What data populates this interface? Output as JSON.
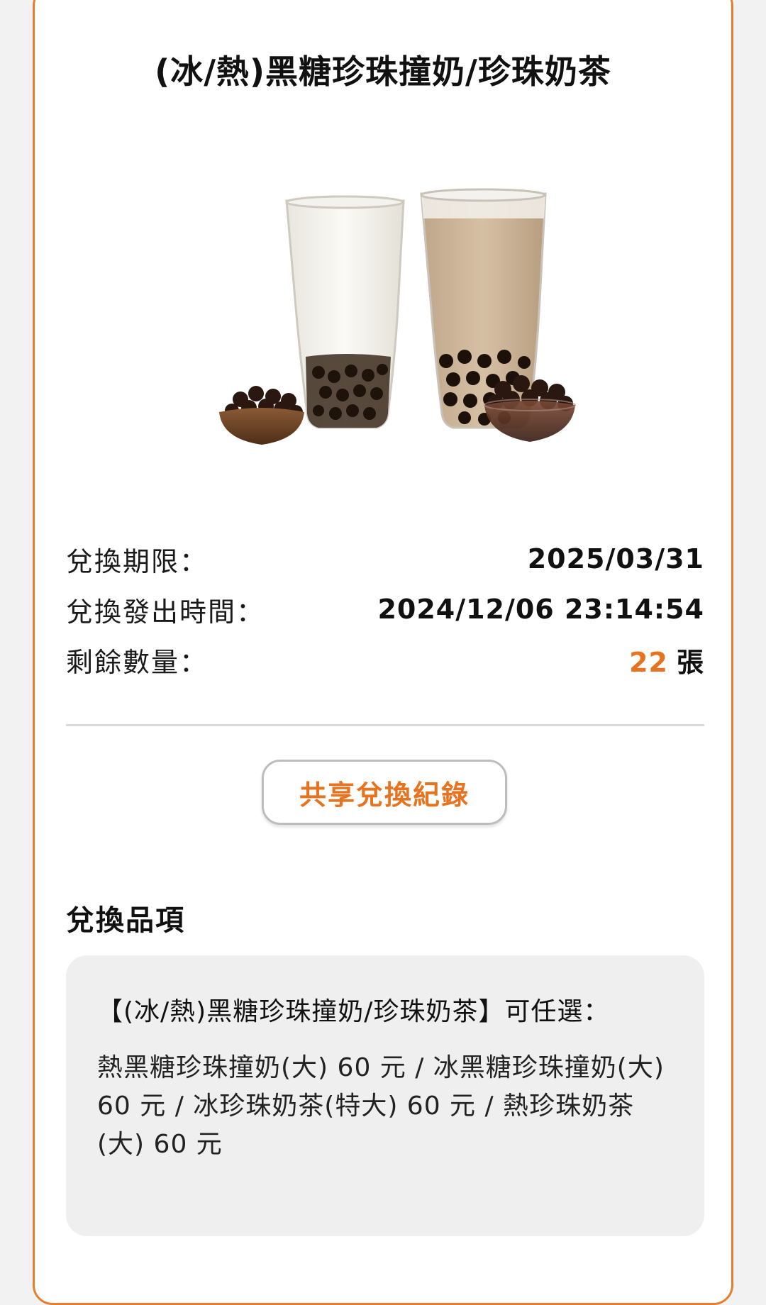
{
  "product": {
    "title": "(冰/熱)黑糖珍珠撞奶/珍珠奶茶"
  },
  "info": {
    "expiry_label": "兌換期限：",
    "expiry_value": "2025/03/31",
    "issued_label": "兌換發出時間：",
    "issued_value": "2024/12/06 23:14:54",
    "remaining_label": "剩餘數量：",
    "remaining_count": "22",
    "remaining_unit": "張"
  },
  "share_button_label": "共享兌換紀錄",
  "items_section": {
    "title": "兌換品項",
    "heading": "【(冰/熱)黑糖珍珠撞奶/珍珠奶茶】可任選：",
    "detail": "熱黑糖珍珠撞奶(大) 60 元 / 冰黑糖珍珠撞奶(大) 60 元 / 冰珍珠奶茶(特大) 60 元 / 熱珍珠奶茶(大) 60 元"
  },
  "colors": {
    "accent": "#e8731f",
    "card_border": "#e87d2e",
    "items_bg": "#efefef"
  }
}
